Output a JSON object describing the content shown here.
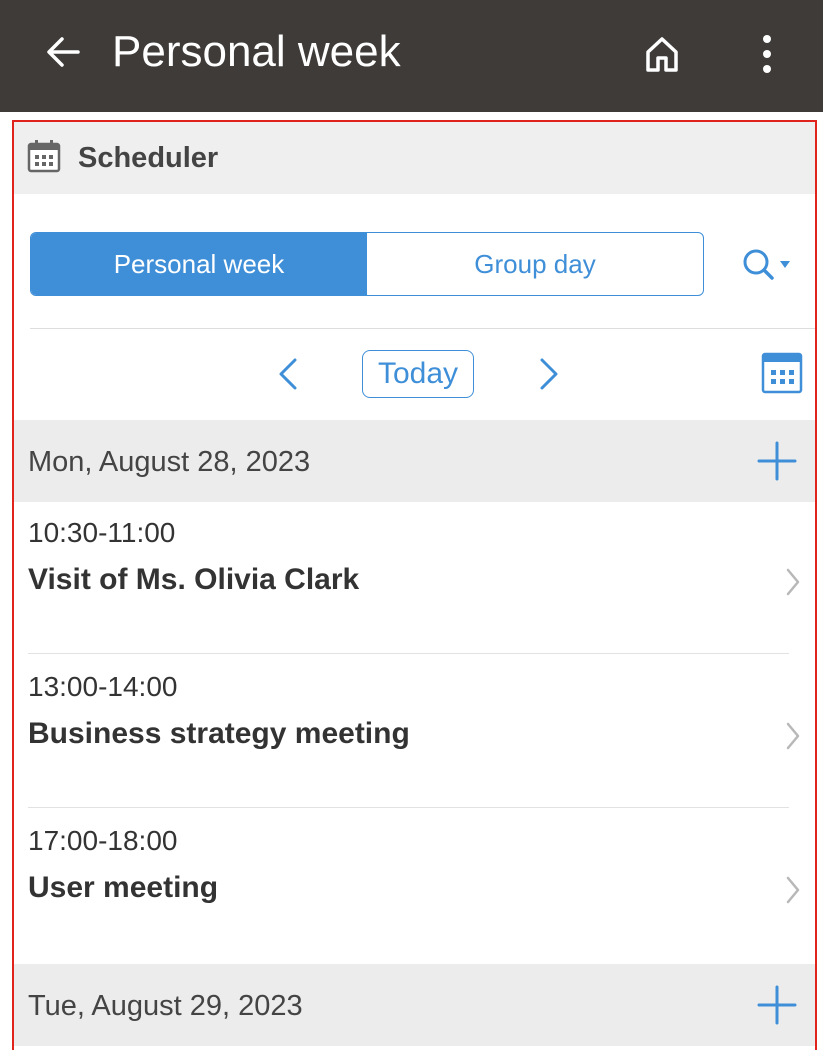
{
  "appbar": {
    "back_icon": "arrow-left-icon",
    "title": "Personal week",
    "home_icon": "home-icon",
    "more_icon": "more-vert-icon"
  },
  "scheduler": {
    "label": "Scheduler",
    "icon": "calendar-icon"
  },
  "view_toggle": {
    "options": [
      "Personal week",
      "Group day"
    ],
    "selected": "Personal week",
    "accent": "#3f8fd8"
  },
  "search": {
    "icon": "search-icon",
    "dropdown_icon": "caret-down-icon"
  },
  "navigation": {
    "prev_icon": "chevron-left-icon",
    "today_label": "Today",
    "next_icon": "chevron-right-icon",
    "calendar_icon": "calendar-icon"
  },
  "days": [
    {
      "date": "Mon, August 28, 2023",
      "events": [
        {
          "time": "10:30-11:00",
          "title": "Visit of Ms. Olivia Clark"
        },
        {
          "time": "13:00-14:00",
          "title": "Business strategy meeting"
        },
        {
          "time": "17:00-18:00",
          "title": "User meeting"
        }
      ]
    },
    {
      "date": "Tue, August 29, 2023",
      "events": []
    }
  ],
  "colors": {
    "appbar_bg": "#3e3b38",
    "accent": "#3f8fd8",
    "highlight_border": "#e0231c"
  }
}
